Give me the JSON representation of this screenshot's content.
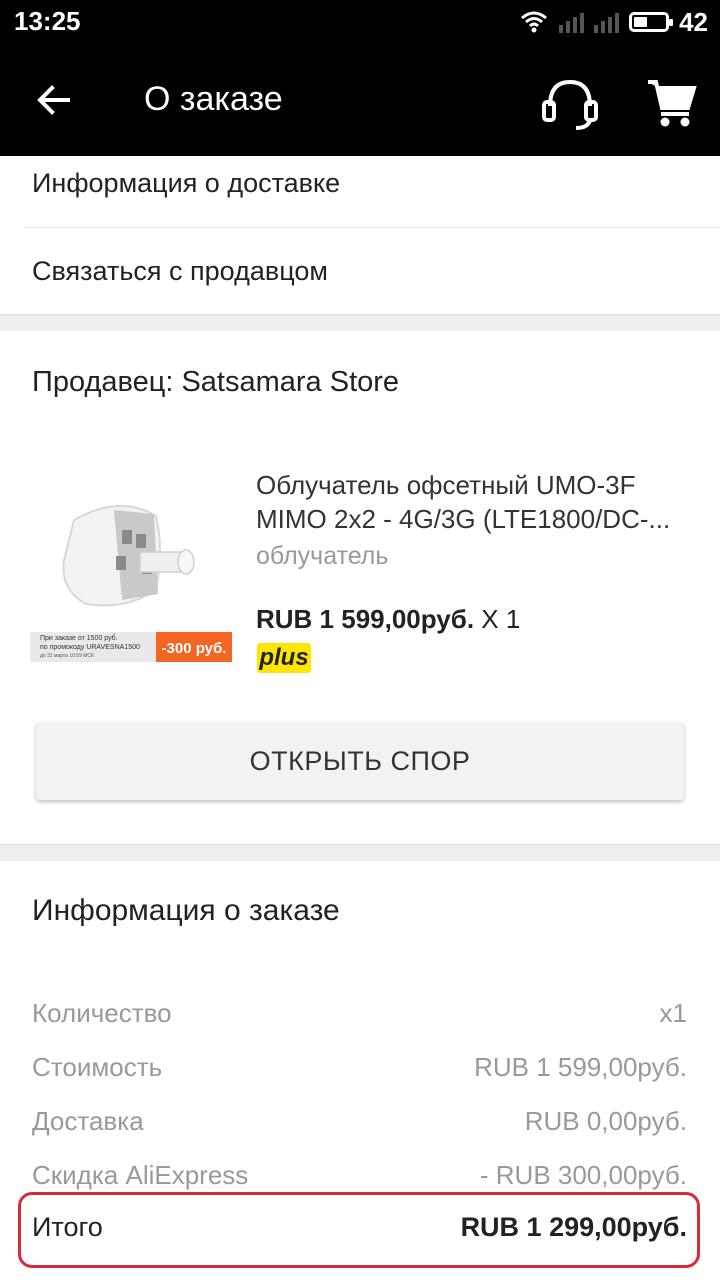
{
  "status_bar": {
    "time": "13:25",
    "battery_level": "42",
    "battery_fill": 0.42
  },
  "app_bar": {
    "title": "О заказе",
    "icons": [
      "back-arrow-icon",
      "headset-icon",
      "cart-icon"
    ]
  },
  "links": {
    "delivery_info": "Информация о доставке",
    "contact_seller": "Связаться с продавцом"
  },
  "seller": {
    "label": "Продавец: Satsamara Store"
  },
  "product": {
    "name": "Облучатель офсетный UMO-3F MIMO 2x2 - 4G/3G (LTE1800/DC-...",
    "variant": "облучатель",
    "price": "RUB 1 599,00руб.",
    "qty": "X 1",
    "badge": "plus",
    "image_promo": {
      "line1": "При заказе от 1500 руб.",
      "line2": "по промокоду URAVESNA1500",
      "line3": "до 31 марта 10:59 МСК",
      "discount": "-300 руб."
    }
  },
  "dispute_button": {
    "label": "ОТКРЫТЬ СПОР"
  },
  "order_info": {
    "title": "Информация о заказе",
    "rows": [
      {
        "label": "Количество",
        "value": "x1"
      },
      {
        "label": "Стоимость",
        "value": "RUB 1 599,00руб."
      },
      {
        "label": "Доставка",
        "value": "RUB 0,00руб."
      },
      {
        "label": "Скидка AliExpress",
        "value": "- RUB 300,00руб."
      }
    ],
    "total": {
      "label": "Итого",
      "value": "RUB 1 299,00руб."
    },
    "highlight_color": "#d52b3a"
  }
}
